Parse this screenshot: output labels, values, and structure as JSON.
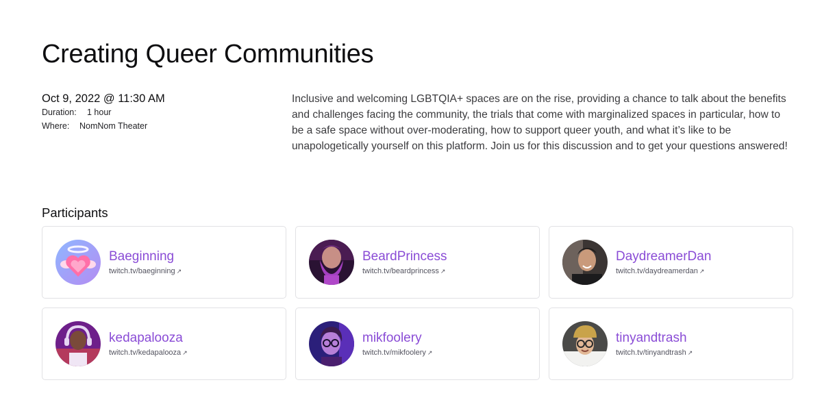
{
  "event": {
    "title": "Creating Queer Communities",
    "date": "Oct 9, 2022 @ 11:30 AM",
    "duration_label": "Duration:",
    "duration_value": "1 hour",
    "where_label": "Where:",
    "where_value": "NomNom Theater",
    "description": "Inclusive and welcoming LGBTQIA+ spaces are on the rise, providing a chance to talk about the benefits and challenges facing the community, the trials that come with marginalized spaces in particular, how to be a safe space without over-moderating, how to support queer youth, and what it’s like to be unapologetically yourself on this platform. Join us for this discussion and to get your questions answered!"
  },
  "participants": {
    "title": "Participants",
    "external_icon": "external-link-arrow-icon",
    "items": [
      {
        "name": "Baeginning",
        "link": "twitch.tv/baeginning",
        "avatar": "heart-halo-avatar"
      },
      {
        "name": "BeardPrincess",
        "link": "twitch.tv/beardprincess",
        "avatar": "bearded-person-avatar"
      },
      {
        "name": "DaydreamerDan",
        "link": "twitch.tv/daydreamerdan",
        "avatar": "smiling-person-avatar"
      },
      {
        "name": "kedapalooza",
        "link": "twitch.tv/kedapalooza",
        "avatar": "headphones-person-avatar"
      },
      {
        "name": "mikfoolery",
        "link": "twitch.tv/mikfoolery",
        "avatar": "glasses-person-avatar"
      },
      {
        "name": "tinyandtrash",
        "link": "twitch.tv/tinyandtrash",
        "avatar": "beanie-person-avatar"
      }
    ]
  },
  "colors": {
    "accent": "#8a4cd6",
    "text": "#0e0e10",
    "muted": "#53535f",
    "border": "#e1e1e4"
  }
}
